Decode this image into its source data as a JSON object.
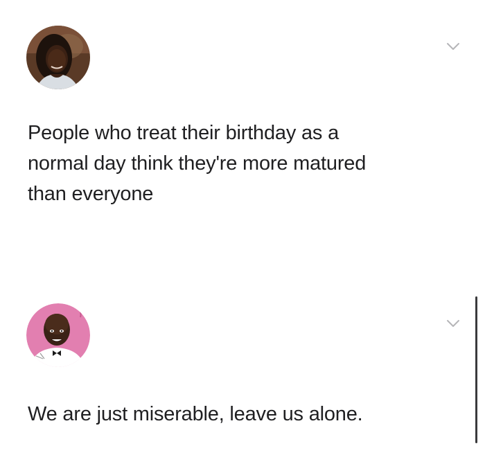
{
  "posts": [
    {
      "text": "People who treat their birthday as a\nnormal day think they're more matured\nthan everyone",
      "avatar_icon": "avatar-woman-photo-icon",
      "menu_icon": "chevron-down-icon"
    },
    {
      "text": "We are just miserable, leave us alone.",
      "avatar_icon": "avatar-bitmoji-man-icon",
      "menu_icon": "chevron-down-icon"
    }
  ],
  "colors": {
    "background": "#ffffff",
    "text": "#1f1f21",
    "chevron": "#b5b5b8",
    "avatar2_bg": "#e27fb0"
  }
}
